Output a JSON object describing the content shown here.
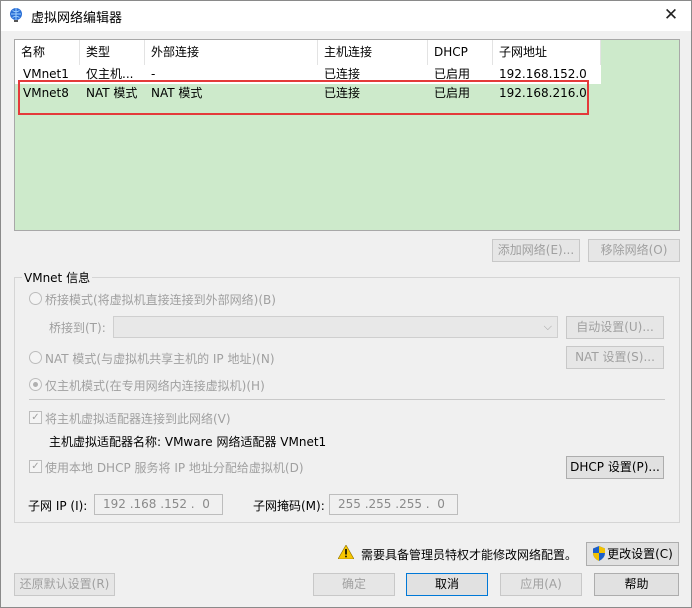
{
  "window": {
    "title": "虚拟网络编辑器",
    "close_glyph": "✕"
  },
  "table": {
    "columns": [
      "名称",
      "类型",
      "外部连接",
      "主机连接",
      "DHCP",
      "子网地址"
    ],
    "rows": [
      [
        "VMnet1",
        "仅主机...",
        "-",
        "已连接",
        "已启用",
        "192.168.152.0"
      ],
      [
        "VMnet8",
        "NAT 模式",
        "NAT 模式",
        "已连接",
        "已启用",
        "192.168.216.0"
      ]
    ],
    "selected_row": 1
  },
  "table_buttons": {
    "add": "添加网络(E)...",
    "remove": "移除网络(O)"
  },
  "vmnet_info": {
    "title": "VMnet 信息",
    "bridged_radio": "桥接模式(将虚拟机直接连接到外部网络)(B)",
    "bridged_to_label": "桥接到(T):",
    "bridged_to_value": "",
    "auto_settings": "自动设置(U)...",
    "nat_radio": "NAT 模式(与虚拟机共享主机的 IP 地址)(N)",
    "nat_settings": "NAT 设置(S)...",
    "host_only_radio": "仅主机模式(在专用网络内连接虚拟机)(H)",
    "connect_host_adapter": "将主机虚拟适配器连接到此网络(V)",
    "host_adapter_name": "主机虚拟适配器名称: VMware 网络适配器 VMnet1",
    "use_dhcp": "使用本地 DHCP 服务将 IP 地址分配给虚拟机(D)",
    "dhcp_settings": "DHCP 设置(P)...",
    "subnet_ip_label": "子网 IP (I):",
    "subnet_ip_value": "192 .168 .152 .  0",
    "subnet_mask_label": "子网掩码(M):",
    "subnet_mask_value": "255 .255 .255 .  0"
  },
  "admin": {
    "notice": "需要具备管理员特权才能修改网络配置。",
    "change_settings": "更改设置(C)"
  },
  "bottom_buttons": {
    "restore": "还原默认设置(R)",
    "ok": "确定",
    "cancel": "取消",
    "apply": "应用(A)",
    "help": "帮助"
  },
  "colors": {
    "selected_row_bg": "#cdeacb",
    "annotation_red": "#e43a3a",
    "primary_border": "#0078d7",
    "warning_yellow": "#f7c600"
  }
}
